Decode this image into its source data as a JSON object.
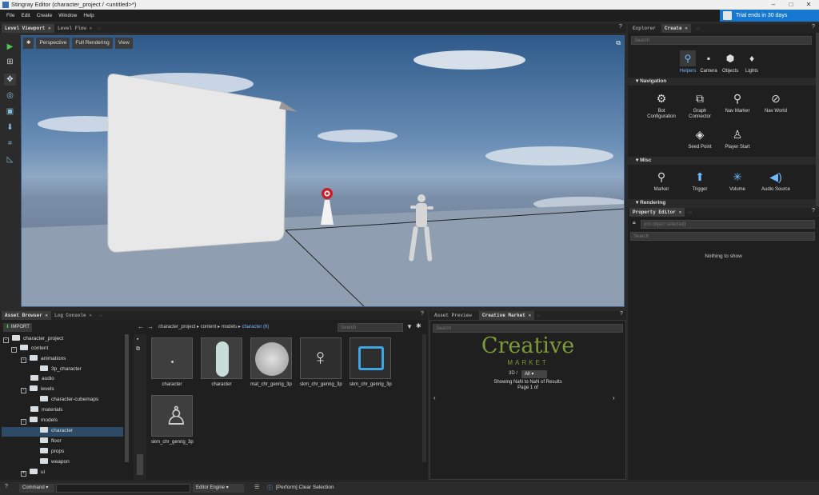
{
  "window": {
    "title": "Stingray Editor (character_project / <untitled>*)"
  },
  "menu": [
    "File",
    "Edit",
    "Create",
    "Window",
    "Help"
  ],
  "trial": {
    "label": "Trial ends in 30 days"
  },
  "viewport_tabs": {
    "tab1": "Level Viewport",
    "tab2": "Level Flow",
    "help": "?"
  },
  "viewport": {
    "btn_perspective": "Perspective",
    "btn_render": "Full Rendering",
    "btn_view": "View"
  },
  "right_tabs": {
    "explorer": "Explorer",
    "create": "Create",
    "help": "?"
  },
  "create": {
    "search_placeholder": "Search",
    "top": [
      "Helpers",
      "Camera",
      "Objects",
      "Lights"
    ],
    "sections": {
      "navigation": "Navigation",
      "misc": "Misc",
      "rendering": "Rendering"
    },
    "nav_items": [
      "Bot Configuration",
      "Graph Connector",
      "Nav Marker",
      "Nav World",
      "Seed Point",
      "Player Start"
    ],
    "misc_items": [
      "Marker",
      "Trigger",
      "Volume",
      "Audio Source"
    ]
  },
  "property_editor": {
    "tab": "Property Editor",
    "no_object": "(no object selected)",
    "search_placeholder": "Search",
    "empty_text": "Nothing to show",
    "help": "?"
  },
  "asset_tabs": {
    "browser": "Asset Browser",
    "log": "Log Console",
    "help": "?"
  },
  "asset_browser": {
    "import": "IMPORT",
    "breadcrumb": [
      "character_project",
      "content",
      "models"
    ],
    "breadcrumb_current": "character (6)",
    "search_placeholder": "Search",
    "tree": [
      {
        "label": "character_project",
        "depth": 0
      },
      {
        "label": "content",
        "depth": 1
      },
      {
        "label": "animations",
        "depth": 2
      },
      {
        "label": "3p_character",
        "depth": 3
      },
      {
        "label": "audio",
        "depth": 2
      },
      {
        "label": "levels",
        "depth": 2
      },
      {
        "label": "character-cubemaps",
        "depth": 3
      },
      {
        "label": "materials",
        "depth": 2
      },
      {
        "label": "models",
        "depth": 2
      },
      {
        "label": "character",
        "depth": 3,
        "selected": true
      },
      {
        "label": "floor",
        "depth": 3
      },
      {
        "label": "props",
        "depth": 3
      },
      {
        "label": "weapon",
        "depth": 3
      },
      {
        "label": "ui",
        "depth": 2
      }
    ],
    "assets": [
      "character",
      "character",
      "mat_chr_genrig_3p",
      "skm_chr_genrig_3p",
      "skm_chr_genrig_3p",
      "skm_chr_genrig_3p"
    ]
  },
  "preview_tabs": {
    "preview": "Asset Preview",
    "market": "Creative Market",
    "help": "?"
  },
  "market": {
    "search_placeholder": "Search",
    "logo_main": "Creative",
    "logo_sub": "MARKET",
    "filter_label": "3D /",
    "filter_value": "All",
    "results": "Showing NaN to NaN of Results",
    "page": "Page 1 of"
  },
  "status": {
    "help": "?",
    "command_label": "Command",
    "engine_label": "Editor Engine",
    "message": "[Perform] Clear Selection"
  },
  "colors": {
    "accent": "#1778d2",
    "market_green": "#7d9a3a",
    "selected_row": "#2d4a66"
  }
}
